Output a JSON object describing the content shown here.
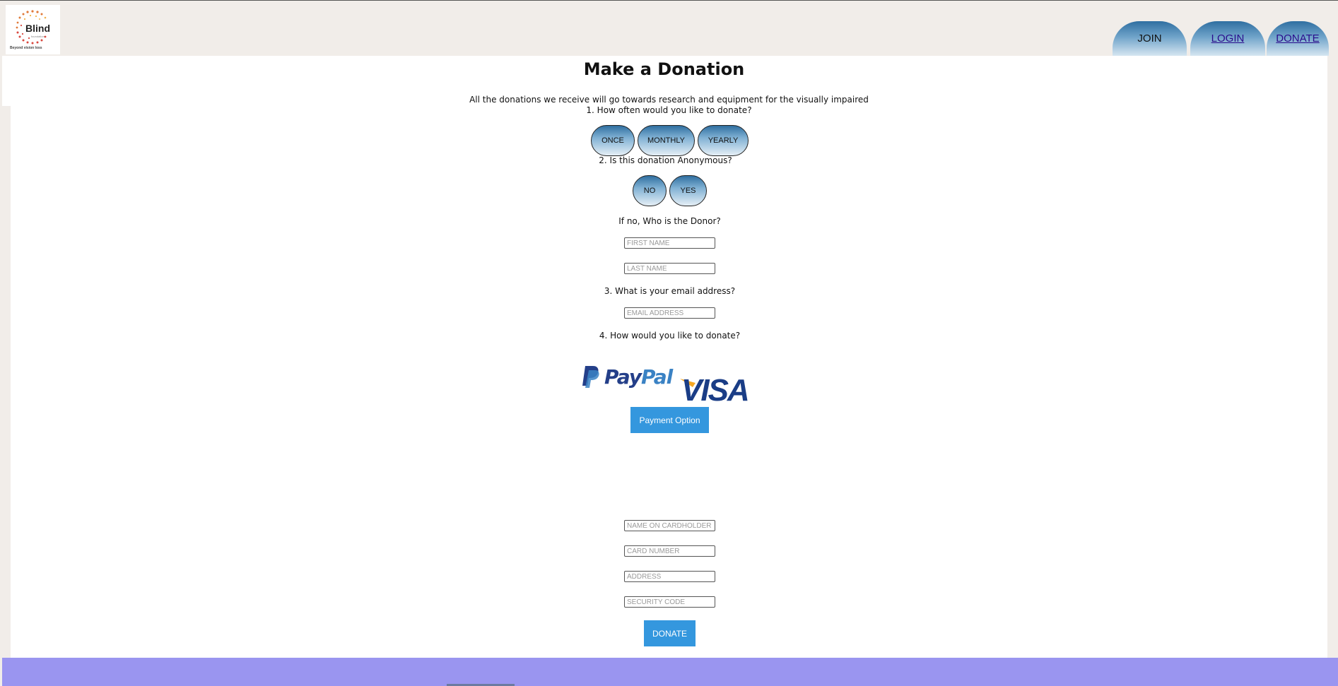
{
  "header": {
    "logo": {
      "name": "Blind",
      "small_text": "foundation",
      "tagline": "Beyond vision loss"
    },
    "nav": [
      {
        "label": "JOIN"
      },
      {
        "label": "LOGIN"
      },
      {
        "label": "DONATE"
      }
    ]
  },
  "main": {
    "title": "Make a Donation",
    "intro": "All the donations we receive will go towards research and equipment for the visually impaired",
    "q1": "1. How often would you like to donate?",
    "frequency_options": [
      "ONCE",
      "MONTHLY",
      "YEARLY"
    ],
    "q2": "2. Is this donation Anonymous?",
    "anonymous_options": [
      "NO",
      "YES"
    ],
    "donor_prompt": "If no, Who is the Donor?",
    "first_name_placeholder": "FIRST NAME",
    "last_name_placeholder": "LAST NAME",
    "q3": "3. What is your email address?",
    "email_placeholder": "EMAIL ADDRESS",
    "q4": "4. How would you like to donate?",
    "payment_logos": {
      "paypal_pay": "Pay",
      "paypal_pal": "Pal",
      "visa": "VISA"
    },
    "payment_option_label": "Payment Option",
    "card_fields": {
      "name_placeholder": "NAME ON CARDHOLDER",
      "card_number_placeholder": "CARD NUMBER",
      "address_placeholder": "ADDRESS",
      "security_code_placeholder": "SECURITY CODE"
    },
    "donate_label": "DONATE"
  },
  "colors": {
    "page_bg": "#f1ede9",
    "button_blue": "#3497de",
    "footer": "#9a95f0",
    "tab_gradient_top": "#2f6fa1"
  }
}
